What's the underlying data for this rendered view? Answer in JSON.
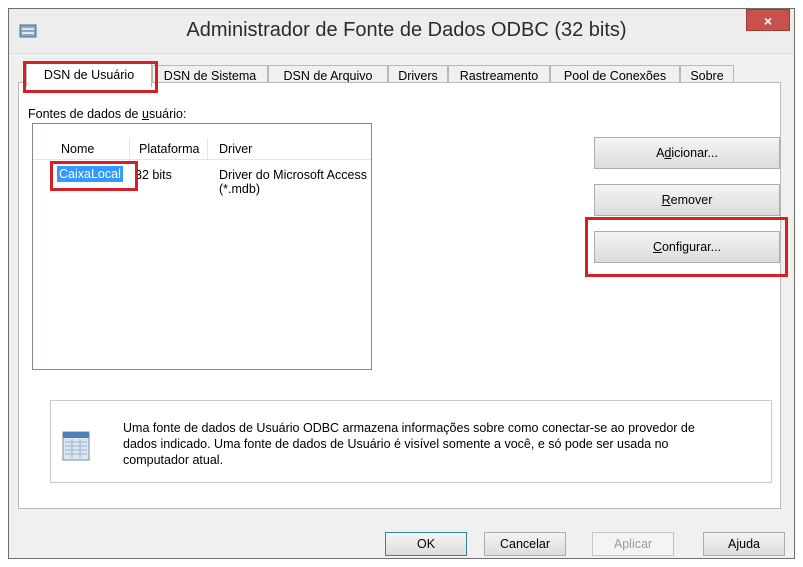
{
  "window": {
    "title": "Administrador de Fonte de Dados ODBC (32 bits)",
    "close_label": "×"
  },
  "tabs": [
    {
      "label": "DSN de Usuário"
    },
    {
      "label": "DSN de Sistema"
    },
    {
      "label": "DSN de Arquivo"
    },
    {
      "label": "Drivers"
    },
    {
      "label": "Rastreamento"
    },
    {
      "label": "Pool de Conexões"
    },
    {
      "label": "Sobre"
    }
  ],
  "list": {
    "label_prefix": "Fontes de dados de ",
    "label_underlined": "u",
    "label_suffix": "suário:",
    "columns": [
      "Nome",
      "Plataforma",
      "Driver"
    ],
    "rows": [
      {
        "name": "CaixaLocal",
        "platform": "32 bits",
        "driver": "Driver do Microsoft Access (*.mdb)"
      }
    ]
  },
  "buttons": {
    "add": {
      "pre": "A",
      "ul": "d",
      "post": "icionar..."
    },
    "remove": {
      "pre": "",
      "ul": "R",
      "post": "emover"
    },
    "configure": {
      "pre": "",
      "ul": "C",
      "post": "onfigurar..."
    }
  },
  "info": {
    "line1": "Uma fonte de dados de Usuário ODBC armazena informações sobre como conectar-se ao provedor de",
    "line2": "dados indicado. Uma fonte de dados de Usuário é visível somente a você, e só pode ser usada no",
    "line3": "computador atual."
  },
  "footer": {
    "ok": "OK",
    "cancel": "Cancelar",
    "apply": "Aplicar",
    "help": "Ajuda"
  },
  "colors": {
    "highlight": "#d42026",
    "selection": "#3399ff",
    "close": "#c7524b"
  }
}
